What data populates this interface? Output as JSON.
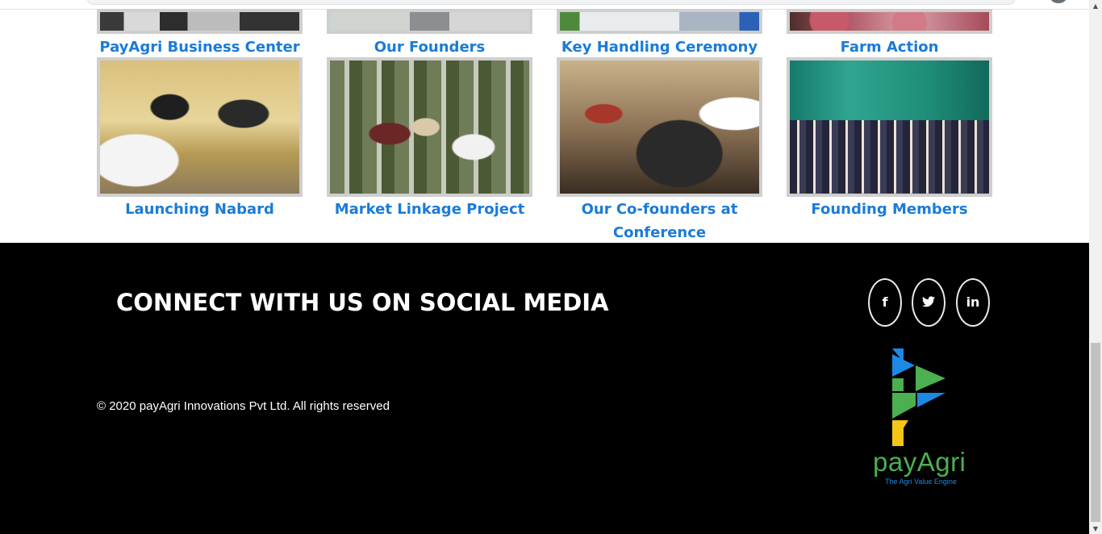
{
  "gallery": {
    "row1": [
      {
        "caption": "PayAgri Business Center",
        "image": "business-center-photo"
      },
      {
        "caption": "Our Founders",
        "image": "founders-photo"
      },
      {
        "caption": "Key Handling Ceremony",
        "image": "key-handling-photo"
      },
      {
        "caption": "Farm Action",
        "image": "farm-action-photo"
      }
    ],
    "row2": [
      {
        "caption": "Launching Nabard",
        "image": "launching-nabard-photo"
      },
      {
        "caption": "Market Linkage Project",
        "image": "market-linkage-photo"
      },
      {
        "caption": "Our Co-founders at Conference",
        "image": "conference-photo"
      },
      {
        "caption": "Founding Members",
        "image": "founding-members-photo"
      }
    ]
  },
  "footer": {
    "heading": "CONNECT WITH US ON SOCIAL MEDIA",
    "social": [
      {
        "label": "f",
        "icon": "facebook-icon"
      },
      {
        "label": "🐦",
        "icon": "twitter-icon"
      },
      {
        "label": "in",
        "icon": "linkedin-icon"
      }
    ],
    "copyright": "© 2020 payAgri Innovations Pvt Ltd. All rights reserved",
    "logo": {
      "word": "payAgri",
      "tagline": "The Agri Value Engine"
    }
  },
  "colors": {
    "caption": "#1a7bd8",
    "footer_bg": "#000000",
    "logo_green": "#4caf50",
    "logo_blue": "#1e88e5",
    "logo_yellow": "#f5c518"
  }
}
